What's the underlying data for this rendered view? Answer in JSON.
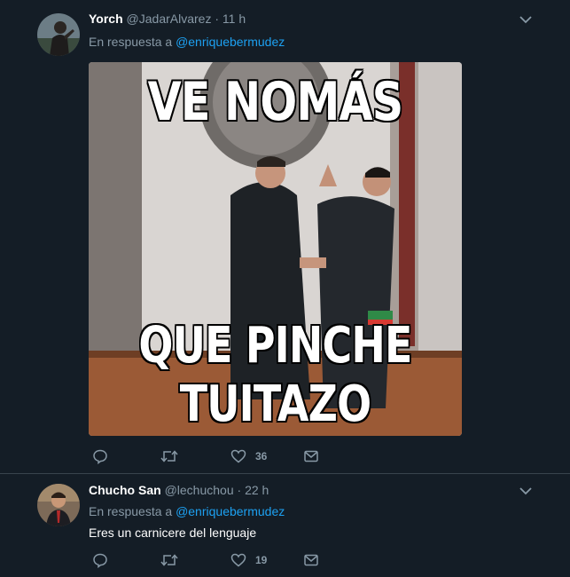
{
  "tweets": [
    {
      "name": "Yorch",
      "handle": "@JadarAlvarez",
      "separator": "·",
      "time": "11 h",
      "reply_prefix": "En respuesta a",
      "reply_to": "@enriquebermudez",
      "media": {
        "caption_top": "VE NOMÁS",
        "caption_mid": "QUE PINCHE",
        "caption_bottom": "TUITAZO"
      },
      "likes": "36"
    },
    {
      "name": "Chucho San",
      "handle": "@lechuchou",
      "separator": "·",
      "time": "22 h",
      "reply_prefix": "En respuesta a",
      "reply_to": "@enriquebermudez",
      "text": "Eres un carnicere del lenguaje",
      "likes": "19"
    }
  ],
  "colors": {
    "background": "#141d26",
    "muted": "#8899a6",
    "link": "#1da1f2",
    "divider": "#38444d"
  },
  "icons": [
    "avatar",
    "chevron-down-icon",
    "reply-icon",
    "retweet-icon",
    "like-icon",
    "dm-icon"
  ]
}
